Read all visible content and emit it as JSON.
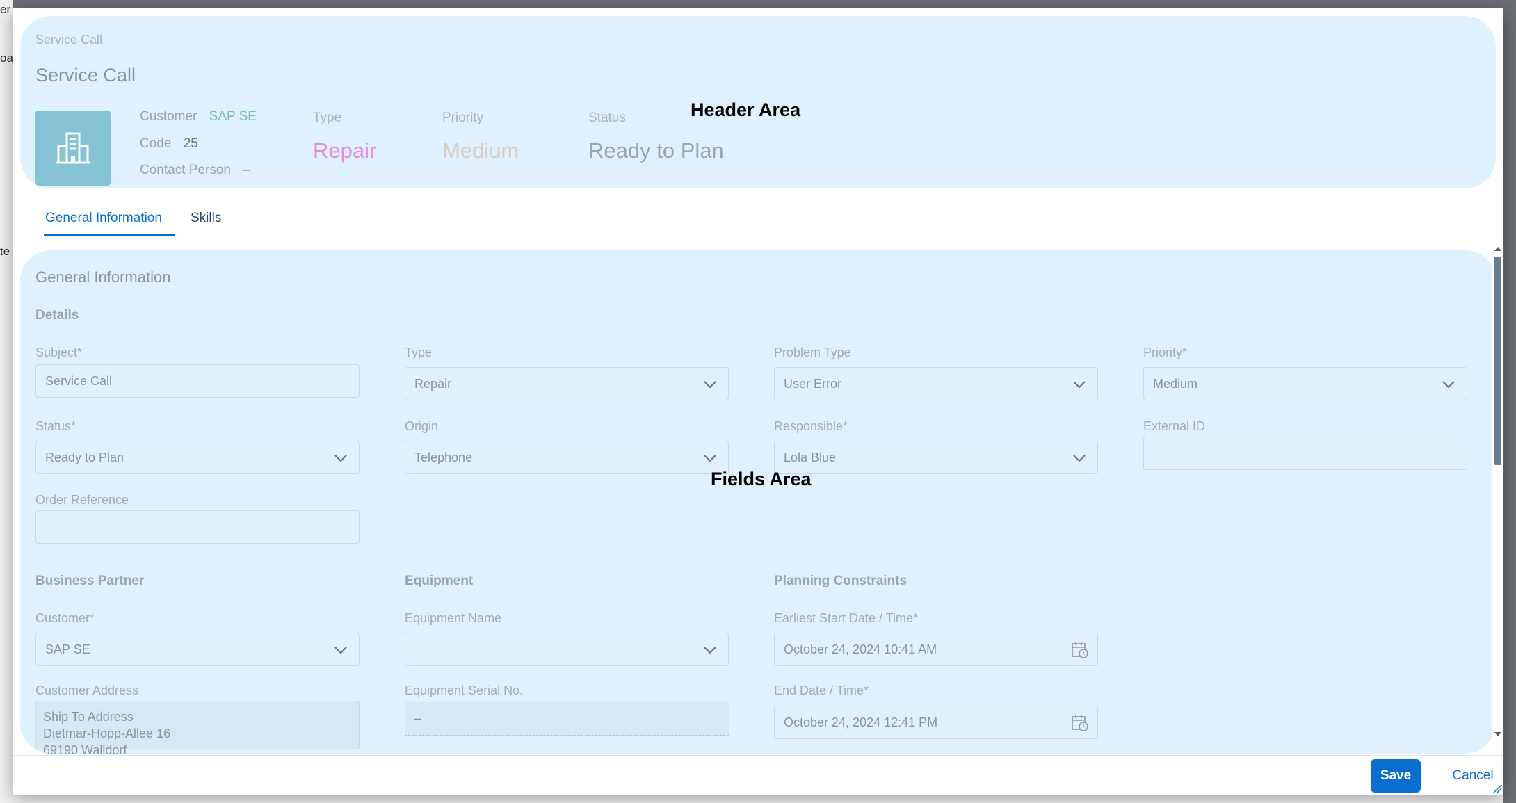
{
  "header": {
    "breadcrumb": "Service Call",
    "title": "Service Call",
    "avatar_icon": "building-icon",
    "customer_label": "Customer",
    "customer_value": "SAP SE",
    "code_label": "Code",
    "code_value": "25",
    "contact_label": "Contact Person",
    "contact_value": "–",
    "kpis": [
      {
        "label": "Type",
        "value": "Repair",
        "color": "#e28de2"
      },
      {
        "label": "Priority",
        "value": "Medium",
        "color": "#d8cdbf"
      },
      {
        "label": "Status",
        "value": "Ready to Plan",
        "color": "#9aa7b3"
      }
    ],
    "area_label": "Header Area"
  },
  "tabs": [
    {
      "label": "General Information",
      "active": true
    },
    {
      "label": "Skills",
      "active": false
    }
  ],
  "fields_area": {
    "section_title": "General Information",
    "area_label": "Fields Area",
    "details_title": "Details",
    "details": {
      "subject": {
        "label": "Subject",
        "required": "*",
        "value": "Service Call"
      },
      "type": {
        "label": "Type",
        "value": "Repair"
      },
      "problem_type": {
        "label": "Problem Type",
        "value": "User Error"
      },
      "priority": {
        "label": "Priority",
        "required": "*",
        "value": "Medium"
      },
      "status": {
        "label": "Status",
        "required": "*",
        "value": "Ready to Plan"
      },
      "origin": {
        "label": "Origin",
        "value": "Telephone"
      },
      "responsible": {
        "label": "Responsible",
        "required": "*",
        "value": "Lola Blue"
      },
      "external_id": {
        "label": "External ID",
        "value": ""
      },
      "order_reference": {
        "label": "Order Reference",
        "value": ""
      }
    },
    "business_partner_title": "Business Partner",
    "equipment_title": "Equipment",
    "planning_title": "Planning Constraints",
    "customer": {
      "label": "Customer",
      "required": "*",
      "value": "SAP SE"
    },
    "customer_address": {
      "label": "Customer Address",
      "line1": "Ship To Address",
      "line2": "Dietmar-Hopp-Allee 16",
      "line3": "69190 Walldorf"
    },
    "equipment_name": {
      "label": "Equipment Name",
      "value": ""
    },
    "equipment_serial": {
      "label": "Equipment Serial No.",
      "value": "–"
    },
    "earliest_start": {
      "label": "Earliest Start Date / Time",
      "required": "*",
      "value": "October 24, 2024 10:41 AM"
    },
    "end_date": {
      "label": "End Date / Time",
      "required": "*",
      "value": "October 24, 2024 12:41 PM"
    }
  },
  "footer": {
    "save_label": "Save",
    "cancel_label": "Cancel"
  },
  "colors": {
    "accent": "#0a6ed1",
    "panel_bg": "#dff1fc"
  }
}
